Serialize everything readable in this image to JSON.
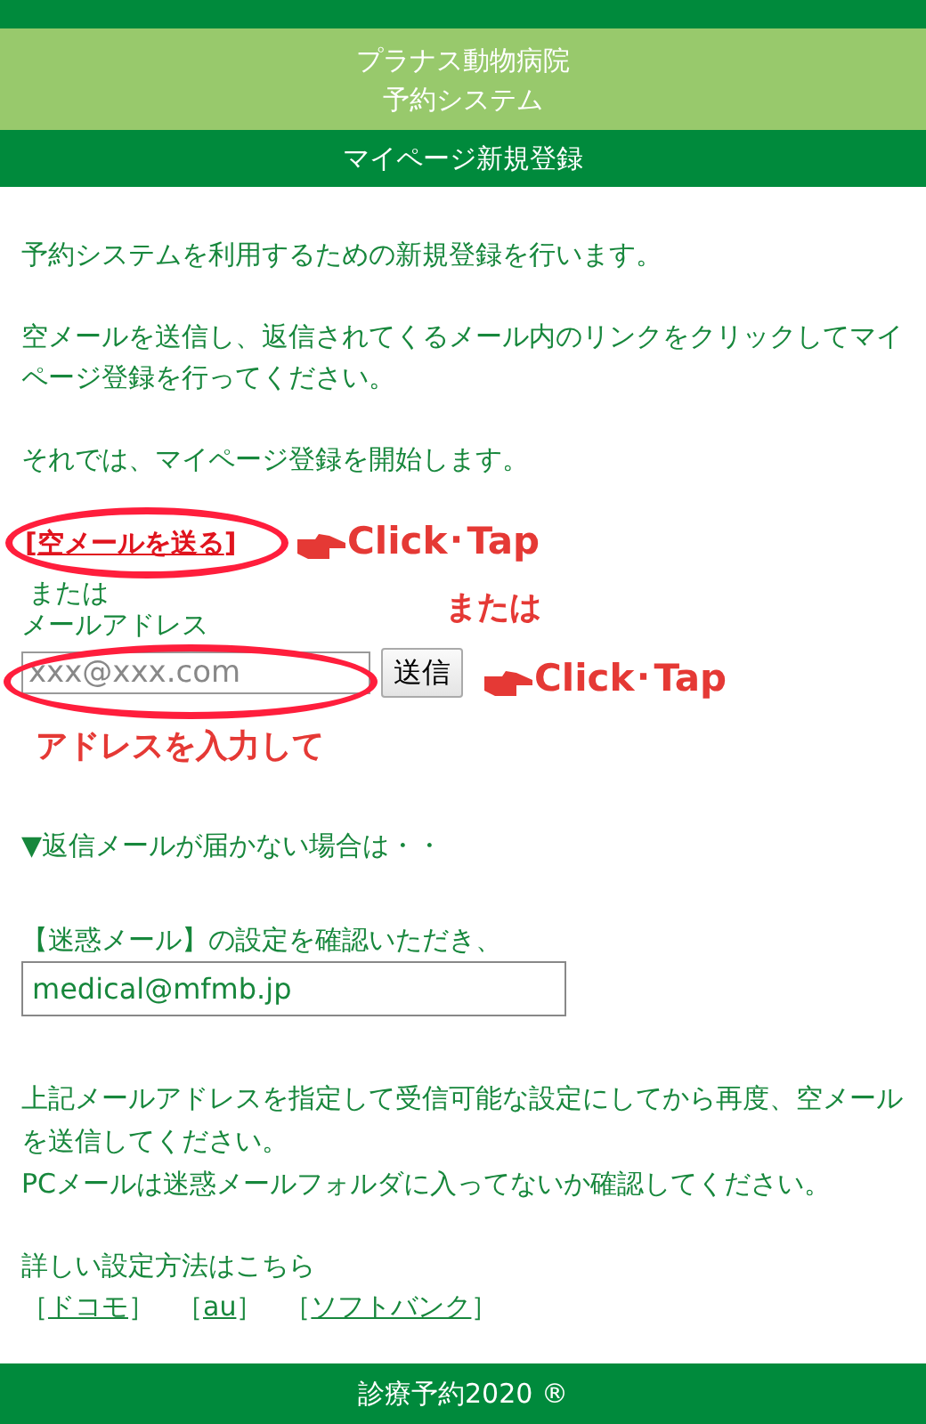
{
  "header": {
    "top_line": "プラナス動物病院",
    "bottom_line": "予約システム"
  },
  "page_title": "マイページ新規登録",
  "intro": [
    "予約システムを利用するための新規登録を行います。",
    "空メールを送信し、返信されてくるメール内のリンクをクリックしてマイページ登録を行ってください。",
    "それでは、マイページ登録を開始します。"
  ],
  "send_link": {
    "bracket_open": "[",
    "label": "空メールを送る",
    "bracket_close": "]"
  },
  "or_text": "または",
  "email_label": "メールアドレス",
  "email_field": {
    "placeholder": "xxx@xxx.com"
  },
  "send_button": "送信",
  "annotations": {
    "link_note": "Click･Tap",
    "or_note": "または",
    "field_note": "Click･Tap",
    "input_note": "アドレスを入力して"
  },
  "notice_heading": "▼返信メールが届かない場合は・・",
  "spam_text": "【迷惑メール】の設定を確認いただき、",
  "address_field": {
    "value": "medical@mfmb.jp"
  },
  "instructions": [
    "上記メールアドレスを指定して受信可能な設定にしてから再度、空メールを送信してください。",
    "PCメールは迷惑メールフォルダに入ってないか確認してください。"
  ],
  "details_text": "詳しい設定方法はこちら",
  "carrier_links": [
    {
      "bracket_open": "［",
      "label": "ドコモ",
      "bracket_close": "］"
    },
    {
      "bracket_open": "［",
      "label": "au",
      "bracket_close": "］"
    },
    {
      "bracket_open": "［",
      "label": "ソフトバンク",
      "bracket_close": "］"
    }
  ],
  "footer": "診療予約2020 ®"
}
